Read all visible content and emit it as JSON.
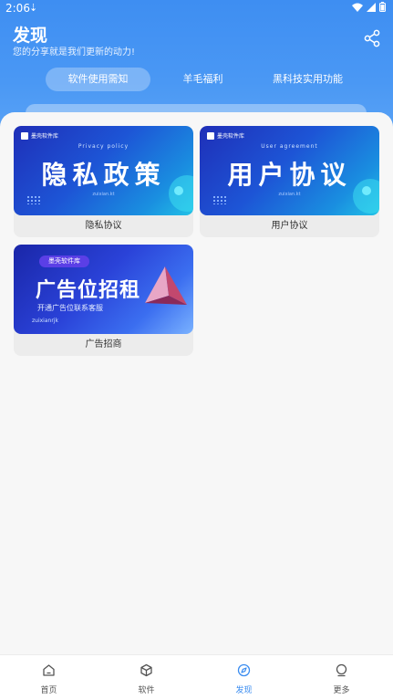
{
  "status_bar": {
    "time": "2:06",
    "notification_icon": "download-icon"
  },
  "header": {
    "title": "发现",
    "subtitle": "您的分享就是我们更新的动力!",
    "share_icon": "share-icon"
  },
  "tabs": [
    {
      "label": "软件使用需知",
      "active": true
    },
    {
      "label": "羊毛福利",
      "active": false
    },
    {
      "label": "黑科技实用功能",
      "active": false
    }
  ],
  "cards": [
    {
      "label": "隐私协议",
      "banner": {
        "brand": "墨壳软件库",
        "english": "Privacy policy",
        "title": "隐私政策",
        "mark": "zuixian.kt"
      }
    },
    {
      "label": "用户协议",
      "banner": {
        "brand": "墨壳软件库",
        "english": "User agreement",
        "title": "用户协议",
        "mark": "zuixian.kt"
      }
    },
    {
      "label": "广告招商",
      "banner": {
        "brand": "墨壳软件库",
        "title": "广告位招租",
        "subtitle": "开通广告位联系客服",
        "mark": "zuixianrjk"
      }
    }
  ],
  "bottom_nav": [
    {
      "label": "首页",
      "icon": "home-icon",
      "active": false
    },
    {
      "label": "软件",
      "icon": "cube-icon",
      "active": false
    },
    {
      "label": "发现",
      "icon": "compass-icon",
      "active": true
    },
    {
      "label": "更多",
      "icon": "profile-icon",
      "active": false
    }
  ],
  "colors": {
    "header_blue": "#3e8ef2",
    "active_nav": "#3a8cf0"
  }
}
